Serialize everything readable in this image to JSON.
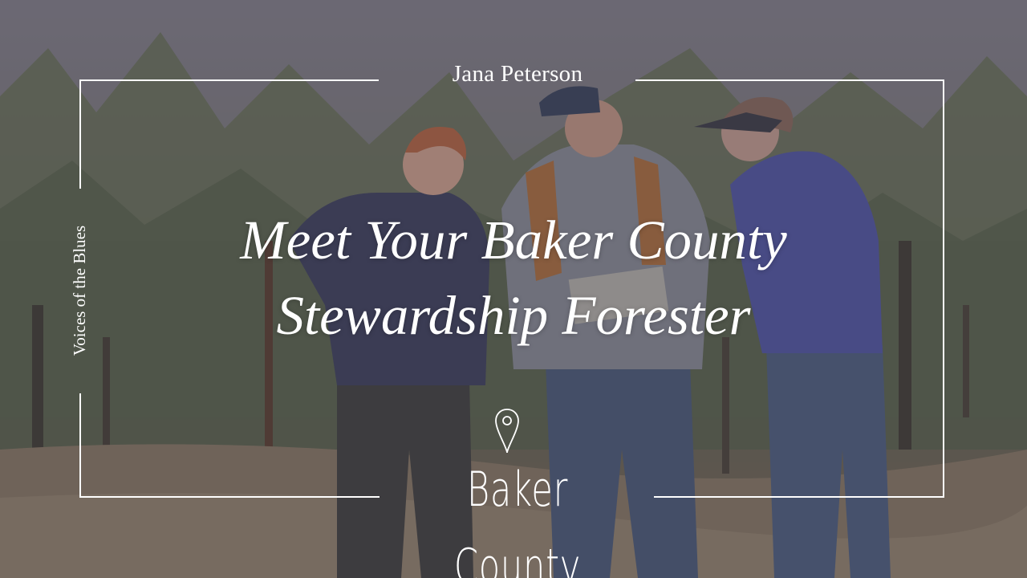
{
  "author": "Jana Peterson",
  "series": "Voices of the Blues",
  "title": {
    "line1": "Meet Your Baker County",
    "line2": "Stewardship Forester"
  },
  "location": {
    "icon": "map-pin-icon",
    "name": "Baker County"
  },
  "colors": {
    "text": "#ffffff",
    "frame": "#ffffff",
    "overlay": "#3a3846"
  }
}
